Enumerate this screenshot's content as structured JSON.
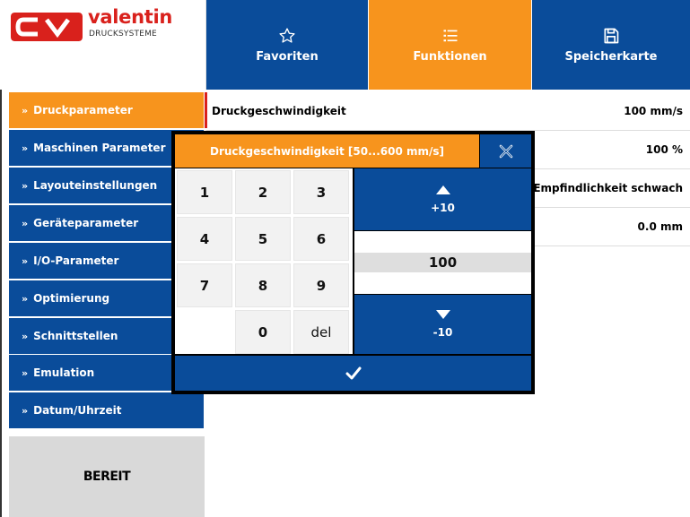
{
  "logo": {
    "brand": "valentin",
    "subtitle": "DRUCKSYSTEME",
    "mark": "CV"
  },
  "topbar": {
    "favorites": {
      "label": "Favoriten",
      "icon": "star-outline-icon"
    },
    "functions": {
      "label": "Funktionen",
      "icon": "list-icon"
    },
    "memory_card": {
      "label": "Speicherkarte",
      "icon": "floppy-disk-icon"
    }
  },
  "sidebar": {
    "items": [
      {
        "label": "Druckparameter",
        "active": true
      },
      {
        "label": "Maschinen Parameter"
      },
      {
        "label": "Layouteinstellungen"
      },
      {
        "label": "Geräteparameter"
      },
      {
        "label": "I/O-Parameter"
      },
      {
        "label": "Optimierung"
      },
      {
        "label": "Schnittstellen"
      },
      {
        "label": "Emulation"
      },
      {
        "label": "Datum/Uhrzeit"
      }
    ],
    "status": "BEREIT"
  },
  "parameters": [
    {
      "label": "Druckgeschwindigkeit",
      "value": "100 mm/s"
    },
    {
      "label": "",
      "value": "100 %"
    },
    {
      "label": "",
      "value": "Empfindlichkeit schwach"
    },
    {
      "label": "",
      "value": "0.0 mm"
    }
  ],
  "dialog": {
    "title": "Druckgeschwindigkeit [50...600 mm/s]",
    "keys": [
      "1",
      "2",
      "3",
      "4",
      "5",
      "6",
      "7",
      "8",
      "9",
      "",
      "0",
      "del"
    ],
    "increment_label": "+10",
    "decrement_label": "-10",
    "value": "100"
  },
  "colors": {
    "blue": "#0a4c9a",
    "orange": "#f7941d",
    "brand_red": "#d9211c",
    "status_grey": "#d9d9d9"
  }
}
